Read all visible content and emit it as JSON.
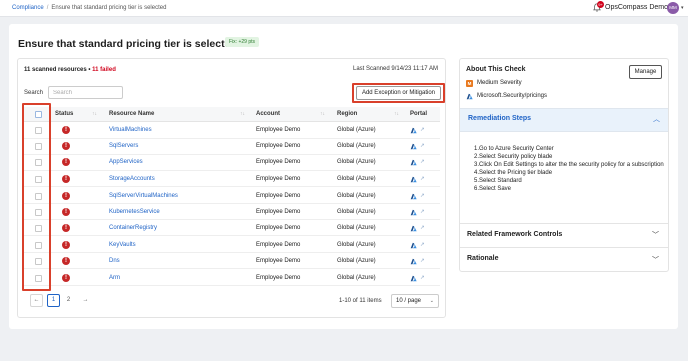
{
  "breadcrumb": {
    "root": "Compliance",
    "separator": "/",
    "current": "Ensure that standard pricing tier is selected"
  },
  "topbar": {
    "notification_count": "9+",
    "user_name": "OpsCompass Demo",
    "avatar_initials": "MM"
  },
  "header": {
    "title": "Ensure that standard pricing tier is selected",
    "fix_badge": "Fix: +29 pts"
  },
  "summary": {
    "scanned": "11 scanned resources",
    "separator": "•",
    "failed": "11 failed",
    "last_scanned": "Last Scanned 9/14/23 11:17 AM"
  },
  "search": {
    "label": "Search",
    "placeholder": "Search",
    "value": ""
  },
  "toolbar": {
    "add_exception_label": "Add Exception or Mitigation"
  },
  "table": {
    "columns": [
      "Status",
      "Resource Name",
      "Account",
      "Region",
      "Portal"
    ],
    "rows": [
      {
        "status": "failed",
        "name": "VirtualMachines",
        "account": "Employee Demo",
        "region": "Global (Azure)"
      },
      {
        "status": "failed",
        "name": "SqlServers",
        "account": "Employee Demo",
        "region": "Global (Azure)"
      },
      {
        "status": "failed",
        "name": "AppServices",
        "account": "Employee Demo",
        "region": "Global (Azure)"
      },
      {
        "status": "failed",
        "name": "StorageAccounts",
        "account": "Employee Demo",
        "region": "Global (Azure)"
      },
      {
        "status": "failed",
        "name": "SqlServerVirtualMachines",
        "account": "Employee Demo",
        "region": "Global (Azure)"
      },
      {
        "status": "failed",
        "name": "KubernetesService",
        "account": "Employee Demo",
        "region": "Global (Azure)"
      },
      {
        "status": "failed",
        "name": "ContainerRegistry",
        "account": "Employee Demo",
        "region": "Global (Azure)"
      },
      {
        "status": "failed",
        "name": "KeyVaults",
        "account": "Employee Demo",
        "region": "Global (Azure)"
      },
      {
        "status": "failed",
        "name": "Dns",
        "account": "Employee Demo",
        "region": "Global (Azure)"
      },
      {
        "status": "failed",
        "name": "Arm",
        "account": "Employee Demo",
        "region": "Global (Azure)"
      }
    ],
    "icons": {
      "status": "error-icon",
      "portal": "azure-logo-icon",
      "link": "external-link-icon"
    }
  },
  "pagination": {
    "prev": "←",
    "pages": [
      "1",
      "2"
    ],
    "current_page": "1",
    "next": "→",
    "info": "1-10 of 11 items",
    "per_page": "10 / page"
  },
  "about": {
    "title": "About This Check",
    "manage_label": "Manage",
    "severity_icon_letter": "M",
    "severity": "Medium Severity",
    "provider": "Microsoft.Security/pricings",
    "severity_color": "#e8791f"
  },
  "remediation": {
    "title": "Remediation Steps",
    "steps": [
      "1.Go to Azure Security Center",
      "2.Select Security policy blade",
      "3.Click On Edit Settings to alter the the security policy for a subscription",
      "4.Select the Pricing tier blade",
      "5.Select Standard",
      "6.Select Save"
    ]
  },
  "sections": {
    "related": "Related Framework Controls",
    "rationale": "Rationale"
  },
  "colors": {
    "link": "#1f63c6",
    "error": "#c62828",
    "highlight": "#d9402b",
    "accent_bg": "#e9f2fb"
  }
}
